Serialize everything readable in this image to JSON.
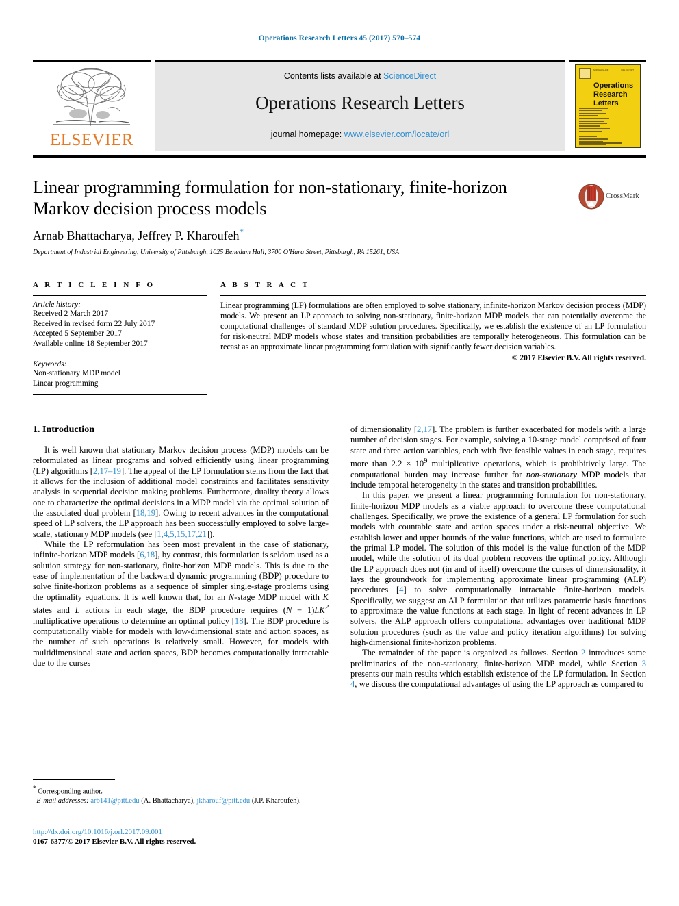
{
  "running_head": "Operations Research Letters 45 (2017) 570–574",
  "masthead": {
    "publisher": "ELSEVIER",
    "contents_prefix": "Contents lists available at ",
    "contents_link": "ScienceDirect",
    "journal_title": "Operations Research Letters",
    "homepage_prefix": "journal homepage: ",
    "homepage_url": "www.elsevier.com/locate/orl",
    "cover": {
      "line1": "Operations",
      "line2": "Research",
      "line3": "Letters",
      "masthead_left": "NORTH-HOLLAND",
      "masthead_right": "ISSN 0167-6377"
    }
  },
  "article": {
    "title": "Linear programming formulation for non-stationary, finite-horizon Markov decision process models",
    "authors": "Arnab Bhattacharya, Jeffrey P. Kharoufeh",
    "corresponding_marker": "*",
    "affiliation": "Department of Industrial Engineering, University of Pittsburgh, 1025 Benedum Hall, 3700 O'Hara Street, Pittsburgh, PA 15261, USA",
    "crossmark_label": "CrossMark"
  },
  "info": {
    "heading": "A R T I C L E   I N F O",
    "history_label": "Article history:",
    "history": [
      "Received 2 March 2017",
      "Received in revised form 22 July 2017",
      "Accepted 5 September 2017",
      "Available online 18 September 2017"
    ],
    "keywords_label": "Keywords:",
    "keywords": [
      "Non-stationary MDP model",
      "Linear programming"
    ]
  },
  "abstract": {
    "heading": "A B S T R A C T",
    "text": "Linear programming (LP) formulations are often employed to solve stationary, infinite-horizon Markov decision process (MDP) models. We present an LP approach to solving non-stationary, finite-horizon MDP models that can potentially overcome the computational challenges of standard MDP solution procedures. Specifically, we establish the existence of an LP formulation for risk-neutral MDP models whose states and transition probabilities are temporally heterogeneous. This formulation can be recast as an approximate linear programming formulation with significantly fewer decision variables.",
    "copyright": "© 2017 Elsevier B.V. All rights reserved."
  },
  "body": {
    "section_heading": "1. Introduction",
    "left_paragraphs": [
      {
        "segments": [
          {
            "t": "It is well known that stationary Markov decision process (MDP) models can be reformulated as linear programs and solved efficiently using linear programming (LP) algorithms ["
          },
          {
            "t": "2,17–19",
            "style": "ref"
          },
          {
            "t": "]. The appeal of the LP formulation stems from the fact that it allows for the inclusion of additional model constraints and facilitates sensitivity analysis in sequential decision making problems. Furthermore, duality theory allows one to characterize the optimal decisions in a MDP model via the optimal solution of the associated dual problem ["
          },
          {
            "t": "18,19",
            "style": "ref"
          },
          {
            "t": "]. Owing to recent advances in the computational speed of LP solvers, the LP approach has been successfully employed to solve large-scale, stationary MDP models (see ["
          },
          {
            "t": "1,4,5,15,17,21",
            "style": "ref"
          },
          {
            "t": "])."
          }
        ]
      },
      {
        "segments": [
          {
            "t": "While the LP reformulation has been most prevalent in the case of stationary, infinite-horizon MDP models ["
          },
          {
            "t": "6,18",
            "style": "ref"
          },
          {
            "t": "], by contrast, this formulation is seldom used as a solution strategy for non-stationary, finite-horizon MDP models. This is due to the ease of implementation of the backward dynamic programming (BDP) procedure to solve finite-horizon problems as a sequence of simpler single-stage problems using the optimality equations. It is well known that, for an "
          },
          {
            "t": "N",
            "style": "ital"
          },
          {
            "t": "-stage MDP model with "
          },
          {
            "t": "K",
            "style": "ital"
          },
          {
            "t": " states and "
          },
          {
            "t": "L",
            "style": "ital"
          },
          {
            "t": " actions in each stage, the BDP procedure requires ("
          },
          {
            "t": "N",
            "style": "ital"
          },
          {
            "t": " − 1)"
          },
          {
            "t": "LK",
            "style": "ital"
          },
          {
            "t": "2",
            "style": "sup-ital"
          },
          {
            "t": " multiplicative operations to determine an optimal policy ["
          },
          {
            "t": "18",
            "style": "ref"
          },
          {
            "t": "]. The BDP procedure is computationally viable for models with low-dimensional state and action spaces, as the number of such operations is relatively small. However, for models with multidimensional state and action spaces, BDP becomes computationally intractable due to the curses"
          }
        ]
      }
    ],
    "right_paragraphs": [
      {
        "first": true,
        "segments": [
          {
            "t": "of dimensionality ["
          },
          {
            "t": "2,17",
            "style": "ref"
          },
          {
            "t": "]. The problem is further exacerbated for models with a large number of decision stages. For example, solving a 10-stage model comprised of four state and three action variables, each with five feasible values in each stage, requires more than 2.2 × 10"
          },
          {
            "t": "9",
            "style": "sup"
          },
          {
            "t": " multiplicative operations, which is prohibitively large. The computational burden may increase further for "
          },
          {
            "t": "non-stationary",
            "style": "ital"
          },
          {
            "t": " MDP models that include temporal heterogeneity in the states and transition probabilities."
          }
        ]
      },
      {
        "segments": [
          {
            "t": "In this paper, we present a linear programming formulation for non-stationary, finite-horizon MDP models as a viable approach to overcome these computational challenges. Specifically, we prove the existence of a general LP formulation for such models with countable state and action spaces under a risk-neutral objective. We establish lower and upper bounds of the value functions, which are used to formulate the primal LP model. The solution of this model is the value function of the MDP model, while the solution of its dual problem recovers the optimal policy. Although the LP approach does not (in and of itself) overcome the curses of dimensionality, it lays the groundwork for implementing approximate linear programming (ALP) procedures ["
          },
          {
            "t": "4",
            "style": "ref"
          },
          {
            "t": "] to solve computationally intractable finite-horizon models. Specifically, we suggest an ALP formulation that utilizes parametric basis functions to approximate the value functions at each stage. In light of recent advances in LP solvers, the ALP approach offers computational advantages over traditional MDP solution procedures (such as the value and policy iteration algorithms) for solving high-dimensional finite-horizon problems."
          }
        ]
      },
      {
        "segments": [
          {
            "t": "The remainder of the paper is organized as follows. Section "
          },
          {
            "t": "2",
            "style": "ref"
          },
          {
            "t": " introduces some preliminaries of the non-stationary, finite-horizon MDP model, while Section "
          },
          {
            "t": "3",
            "style": "ref"
          },
          {
            "t": " presents our main results which establish existence of the LP formulation. In Section "
          },
          {
            "t": "4",
            "style": "ref"
          },
          {
            "t": ", we discuss the computational advantages of using the LP approach as compared to"
          }
        ]
      }
    ]
  },
  "footnote": {
    "corresponding": "Corresponding author.",
    "corresponding_marker": "*",
    "email_label": "E-mail addresses:",
    "email1": "arb141@pitt.edu",
    "email1_who": "(A. Bhattacharya)",
    "email2": "jkharouf@pitt.edu",
    "email2_who": "(J.P. Kharoufeh).",
    "doi": "http://dx.doi.org/10.1016/j.orl.2017.09.001",
    "issn": "0167-6377/© 2017 Elsevier B.V. All rights reserved."
  },
  "colors": {
    "link": "#2f8fd0",
    "running_head": "#1070a8",
    "elsevier_orange": "#e87722",
    "cover_yellow": "#f3cf12",
    "band_gray": "#e6e6e6"
  }
}
